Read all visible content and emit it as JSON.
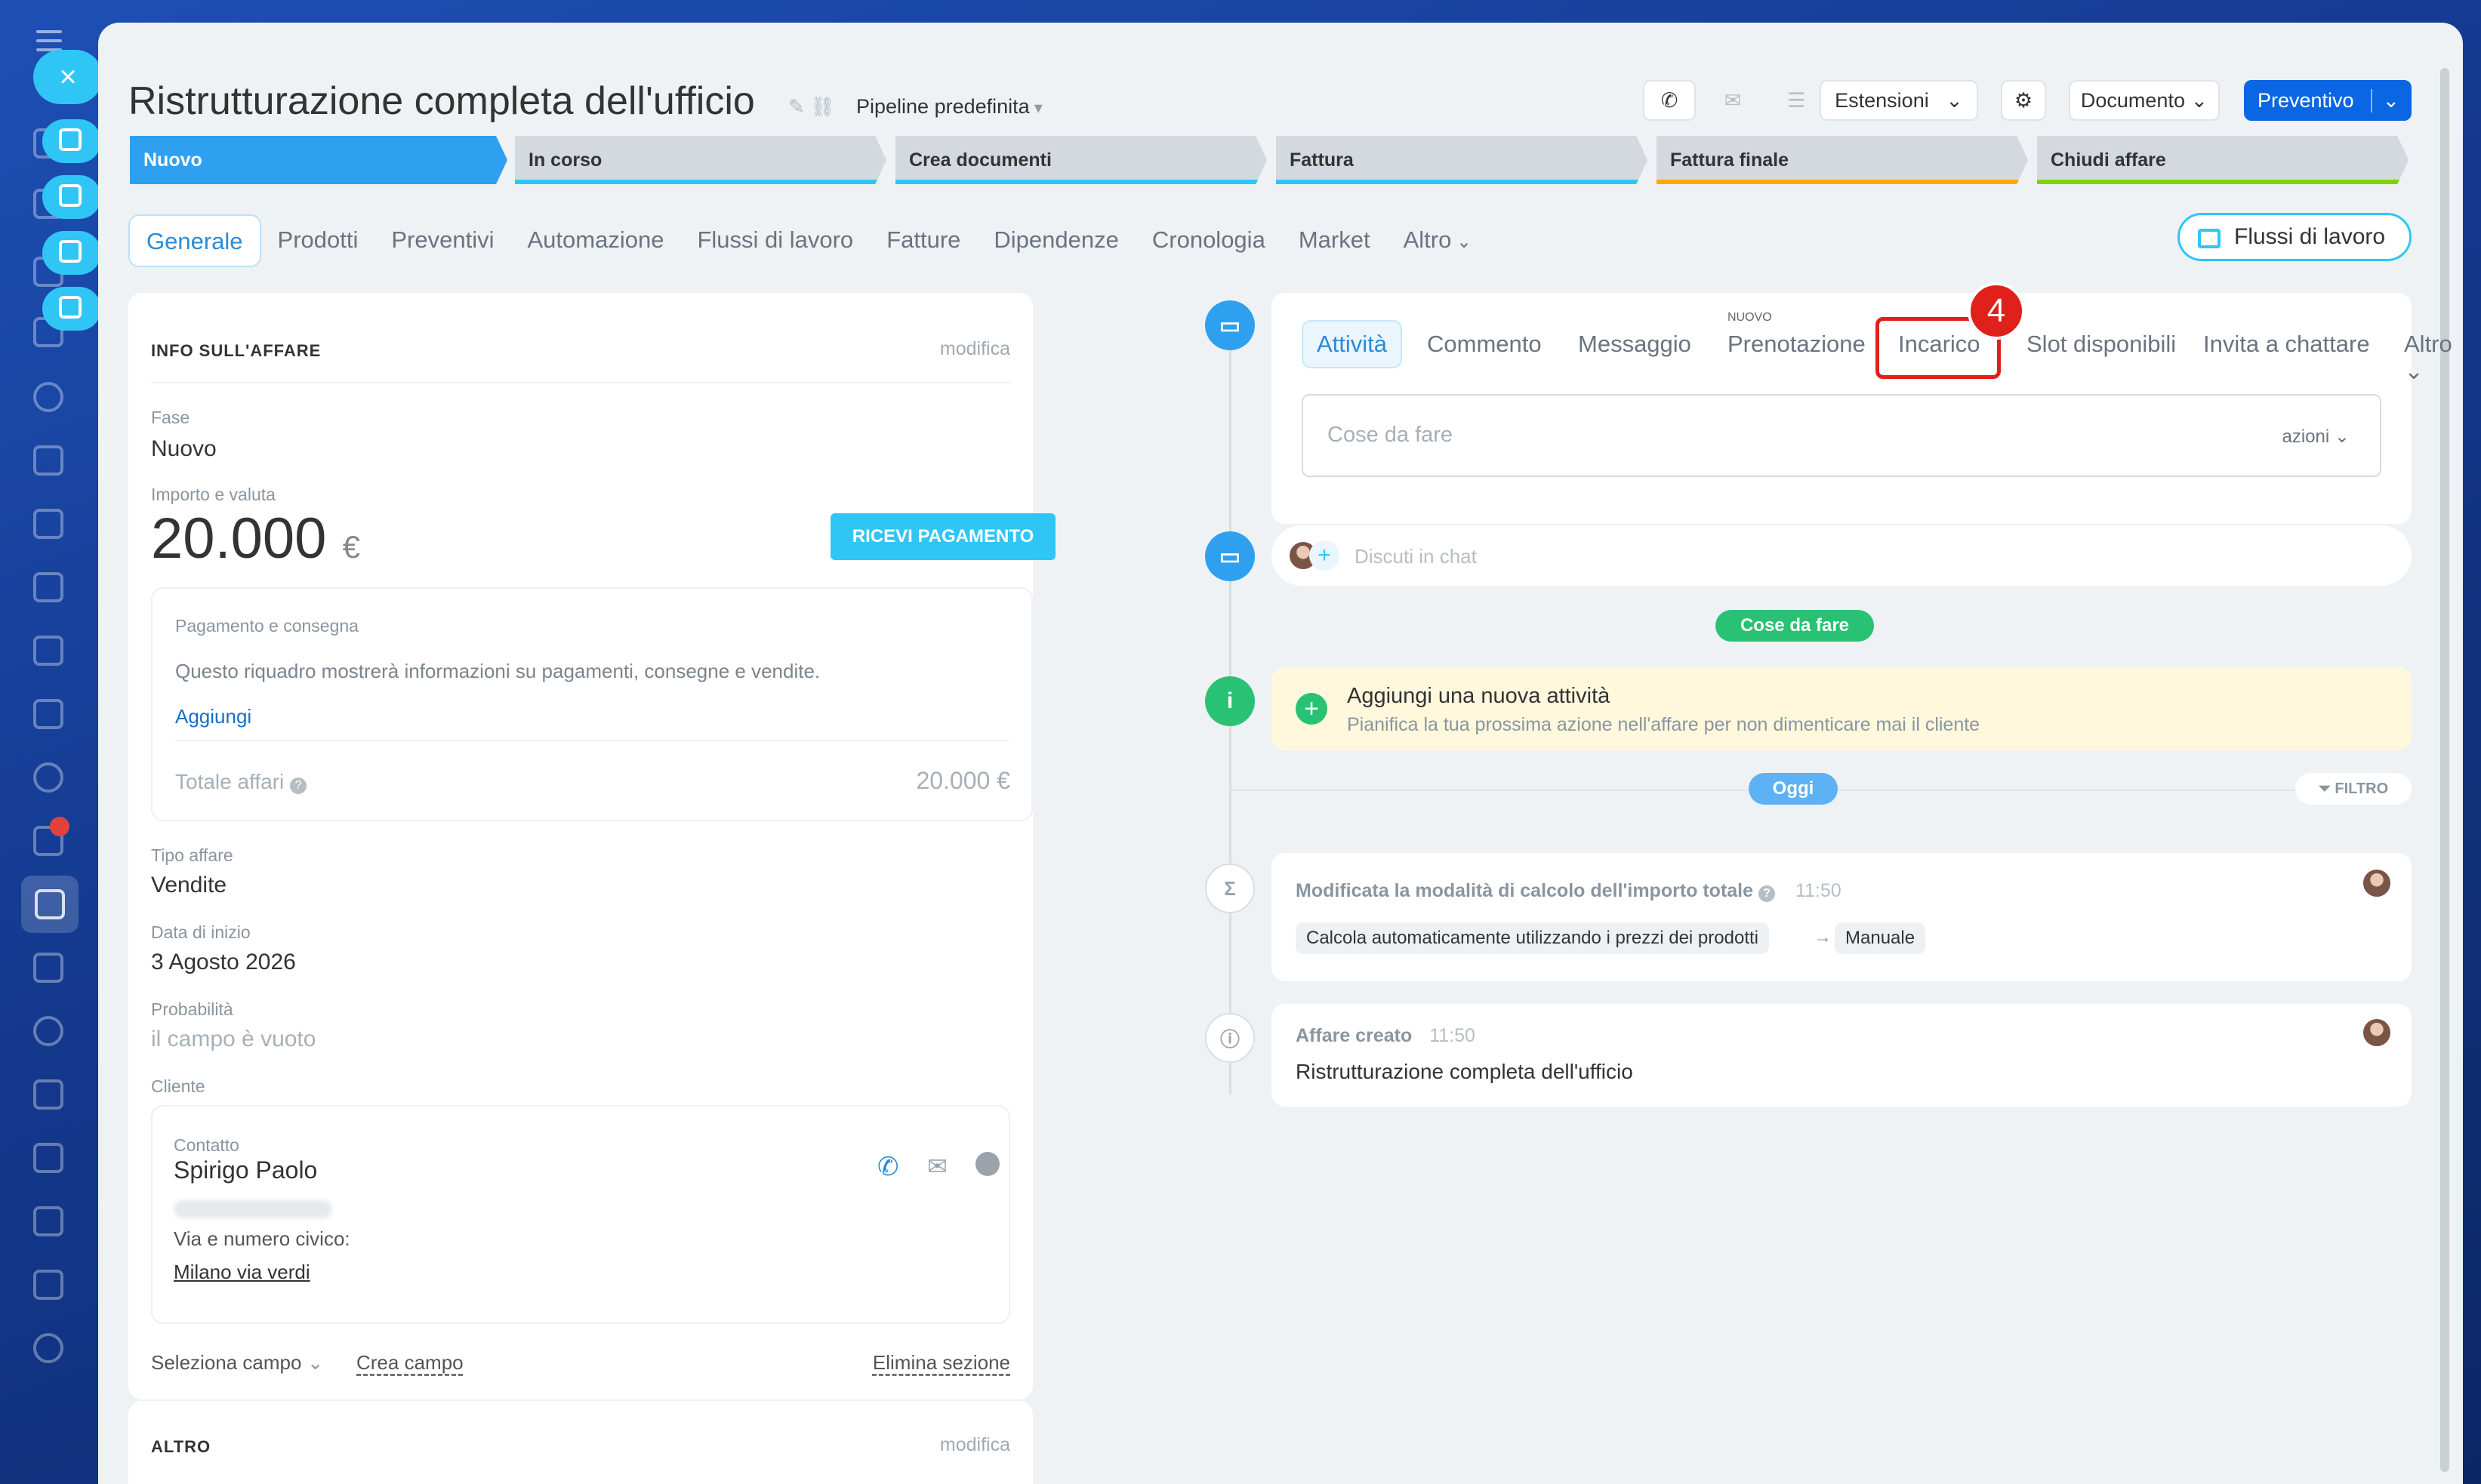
{
  "header": {
    "title": "Ristrutturazione completa dell'ufficio",
    "pipeline": "Pipeline predefinita",
    "extensions": "Estensioni",
    "document": "Documento",
    "quote": "Preventivo"
  },
  "stages": [
    {
      "label": "Nuovo",
      "color": "#2fa0f0"
    },
    {
      "label": "In corso",
      "color": "#2fc6f6"
    },
    {
      "label": "Crea documenti",
      "color": "#2fc6f6"
    },
    {
      "label": "Fattura",
      "color": "#2fc6f6"
    },
    {
      "label": "Fattura finale",
      "color": "#ffa900"
    },
    {
      "label": "Chiudi affare",
      "color": "#7bd500"
    }
  ],
  "tabs": [
    "Generale",
    "Prodotti",
    "Preventivi",
    "Automazione",
    "Flussi di lavoro",
    "Fatture",
    "Dipendenze",
    "Cronologia",
    "Market",
    "Altro"
  ],
  "workflows_button": "Flussi di lavoro",
  "deal_info": {
    "heading": "INFO SULL'AFFARE",
    "edit": "modifica",
    "stage_label": "Fase",
    "stage_value": "Nuovo",
    "amount_label": "Importo e valuta",
    "amount": "20.000",
    "currency": "€",
    "receive_payment": "RICEVI PAGAMENTO",
    "payment_title": "Pagamento e consegna",
    "payment_text": "Questo riquadro mostrerà informazioni su pagamenti, consegne e vendite.",
    "payment_add": "Aggiungi",
    "total_label": "Totale affari",
    "total_value": "20.000 €",
    "type_label": "Tipo affare",
    "type_value": "Vendite",
    "start_label": "Data di inizio",
    "start_value": "3 Agosto 2026",
    "prob_label": "Probabilità",
    "prob_value": "il campo è vuoto",
    "client_label": "Cliente",
    "contact_label": "Contatto",
    "contact_name": "Spirigo Paolo",
    "address_label": "Via e numero civico:",
    "address_value": "Milano via verdi",
    "select_field": "Seleziona campo",
    "create_field": "Crea campo",
    "delete_section": "Elimina sezione"
  },
  "other_section": {
    "heading": "ALTRO",
    "edit": "modifica"
  },
  "activity": {
    "tabs": [
      "Attività",
      "Commento",
      "Messaggio",
      "Prenotazione",
      "Incarico",
      "Slot disponibili",
      "Invita a chattare",
      "Altro"
    ],
    "new_badge": "NUOVO",
    "step_marker": "4",
    "todo_placeholder": "Cose da fare",
    "actions": "azioni",
    "chat_placeholder": "Discuti in chat",
    "todo_pill": "Cose da fare",
    "add_title": "Aggiungi una nuova attività",
    "add_sub": "Pianifica la tua prossima azione nell'affare per non dimenticare mai il cliente",
    "today_pill": "Oggi",
    "filter": "FILTRO",
    "event1_title": "Modificata la modalità di calcolo dell'importo totale",
    "event1_time": "11:50",
    "event1_from": "Calcola automaticamente utilizzando i prezzi dei prodotti",
    "event1_arrow": "→",
    "event1_to": "Manuale",
    "event2_title": "Affare creato",
    "event2_time": "11:50",
    "event2_text": "Ristrutturazione completa dell'ufficio"
  }
}
